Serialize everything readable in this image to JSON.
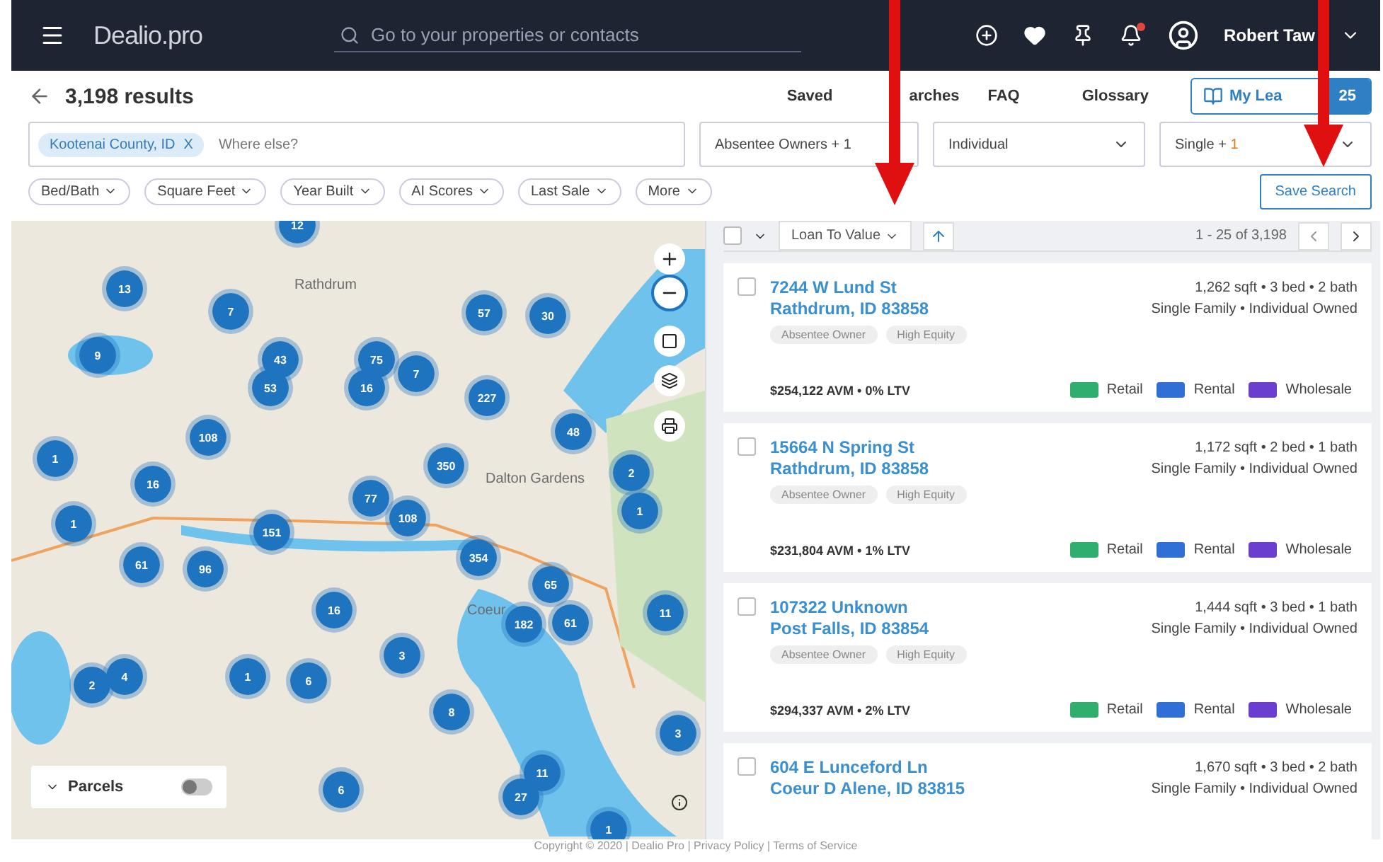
{
  "header": {
    "logo": "Dealio.pro",
    "search": {
      "placeholder": "Go to your properties or contacts"
    },
    "notification_dot": true,
    "user": "Robert Taw"
  },
  "results": {
    "count": "3,198 results",
    "saved_searches": [
      "Saved",
      "arches"
    ],
    "links": [
      "FAQ",
      "Glossary"
    ],
    "my_leads": {
      "label": "My Lea",
      "count": "25"
    }
  },
  "filters": {
    "location_tag": "Kootenai County, ID",
    "remove": "X",
    "location_placeholder": "Where else?",
    "dropdowns": [
      {
        "label": "Absentee Owners + 1"
      },
      {
        "label": "Individual"
      },
      {
        "label": "Single + ",
        "accent": "1"
      }
    ]
  },
  "chips": [
    "Bed/Bath",
    "Square Feet",
    "Year Built",
    "AI Scores",
    "Last Sale",
    "More"
  ],
  "save_search": "Save Search",
  "map": {
    "places": [
      "Rathdrum",
      "Dalton Gardens",
      "Coeur"
    ],
    "clusters": [
      "12",
      "13",
      "7",
      "9",
      "43",
      "53",
      "75",
      "16",
      "7",
      "57",
      "30",
      "227",
      "48",
      "108",
      "1",
      "16",
      "350",
      "2",
      "1",
      "77",
      "108",
      "1",
      "151",
      "61",
      "96",
      "354",
      "65",
      "16",
      "182",
      "61",
      "11",
      "3",
      "2",
      "4",
      "1",
      "6",
      "8",
      "3",
      "11",
      "27",
      "6",
      "1"
    ],
    "parcels": {
      "label": "Parcels",
      "on": false
    }
  },
  "list_toolbar": {
    "select_all": false,
    "sort": "Loan To Value",
    "pagination": "1 - 25 of 3,198"
  },
  "properties": [
    {
      "street": "7244 W Lund St",
      "city": "Rathdrum, ID 83858",
      "tags": [
        "Absentee Owner",
        "High Equity"
      ],
      "size": "1,262 sqft • 3 bed • 2 bath",
      "type": "Single Family • Individual Owned",
      "value": "$254,122 AVM • 0% LTV",
      "checked": false,
      "scores": [
        {
          "label": "Retail",
          "color": "#2fae6e"
        },
        {
          "label": "Rental",
          "color": "#2f6fd6"
        },
        {
          "label": "Wholesale",
          "color": "#6a3fcf"
        }
      ]
    },
    {
      "street": "15664 N Spring St",
      "city": "Rathdrum, ID 83858",
      "tags": [
        "Absentee Owner",
        "High Equity"
      ],
      "size": "1,172 sqft • 2 bed • 1 bath",
      "type": "Single Family • Individual Owned",
      "value": "$231,804 AVM • 1% LTV",
      "checked": false,
      "scores": [
        {
          "label": "Retail",
          "color": "#2fae6e"
        },
        {
          "label": "Rental",
          "color": "#2f6fd6"
        },
        {
          "label": "Wholesale",
          "color": "#6a3fcf"
        }
      ]
    },
    {
      "street": "107322 Unknown",
      "city": "Post Falls, ID 83854",
      "tags": [
        "Absentee Owner",
        "High Equity"
      ],
      "size": "1,444 sqft • 3 bed • 1 bath",
      "type": "Single Family • Individual Owned",
      "value": "$294,337 AVM • 2% LTV",
      "checked": false,
      "scores": [
        {
          "label": "Retail",
          "color": "#2fae6e"
        },
        {
          "label": "Rental",
          "color": "#2f6fd6"
        },
        {
          "label": "Wholesale",
          "color": "#6a3fcf"
        }
      ]
    },
    {
      "street": "604 E Lunceford Ln",
      "city": "Coeur D Alene, ID 83815",
      "size": "1,670 sqft • 3 bed • 2 bath",
      "type": "Single Family • Individual Owned",
      "checked": false
    }
  ],
  "footer": "Copyright © 2020 | Dealio Pro | Privacy Policy | Terms of Service"
}
